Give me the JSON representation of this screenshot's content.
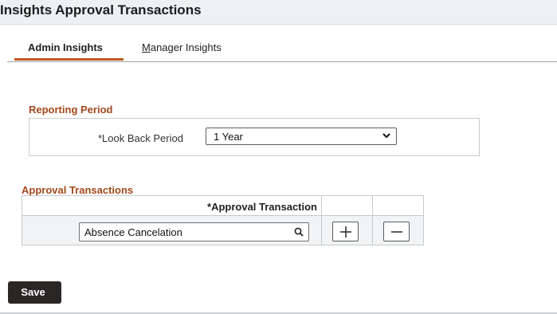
{
  "header": {
    "title": "Insights Approval Transactions"
  },
  "tabs": [
    {
      "label": "Admin Insights",
      "selected": true
    },
    {
      "label_underlined": "M",
      "label_rest": "anager Insights",
      "selected": false
    }
  ],
  "reporting_period": {
    "title": "Reporting Period",
    "look_back_label": "*Look Back Period",
    "look_back_value": "1 Year"
  },
  "approval_transactions": {
    "title": "Approval Transactions",
    "column_header": "*Approval Transaction",
    "rows": [
      {
        "value": "Absence Cancelation"
      }
    ]
  },
  "buttons": {
    "save": "Save"
  },
  "icons": {
    "search": "search-icon",
    "add": "plus-icon",
    "remove": "minus-icon",
    "dropdown": "chevron-down-icon"
  },
  "colors": {
    "accent": "#c1571d",
    "section_title": "#a1481a",
    "save_bg": "#2a2625",
    "header_bg": "#eef1f3"
  }
}
